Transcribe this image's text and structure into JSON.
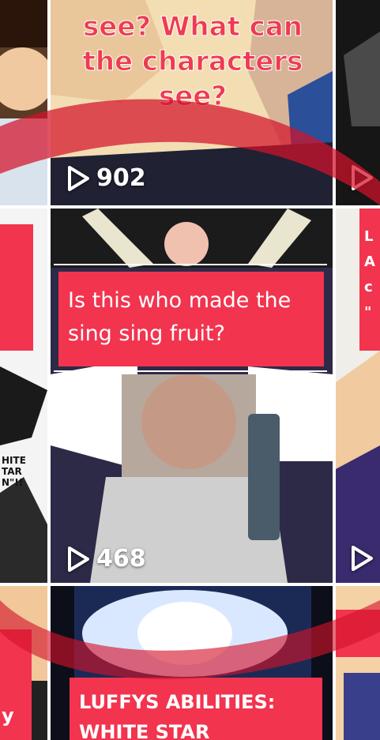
{
  "grid": {
    "tiles": [
      {
        "id": "r1c1",
        "caption": "",
        "views": ""
      },
      {
        "id": "r1c2",
        "caption": "see? What can the characters see?",
        "views": "902"
      },
      {
        "id": "r1c3",
        "caption": "",
        "views": ""
      },
      {
        "id": "r2c1",
        "caption": "HITE TAR N\"!!",
        "views": ""
      },
      {
        "id": "r2c2",
        "caption": "Is this who made the sing sing fruit?",
        "views": "468"
      },
      {
        "id": "r2c3",
        "caption": "L A c \"",
        "views": ""
      },
      {
        "id": "r3c1",
        "caption": "y",
        "views": ""
      },
      {
        "id": "r3c2",
        "caption": "LUFFYS ABILITIES: WHITE STAR",
        "views": ""
      },
      {
        "id": "r3c3",
        "caption": "",
        "views": ""
      }
    ]
  },
  "colors": {
    "accent": "#f2344f",
    "swoosh": "#e0202f"
  },
  "icons": {
    "play": "play-outline-icon"
  }
}
